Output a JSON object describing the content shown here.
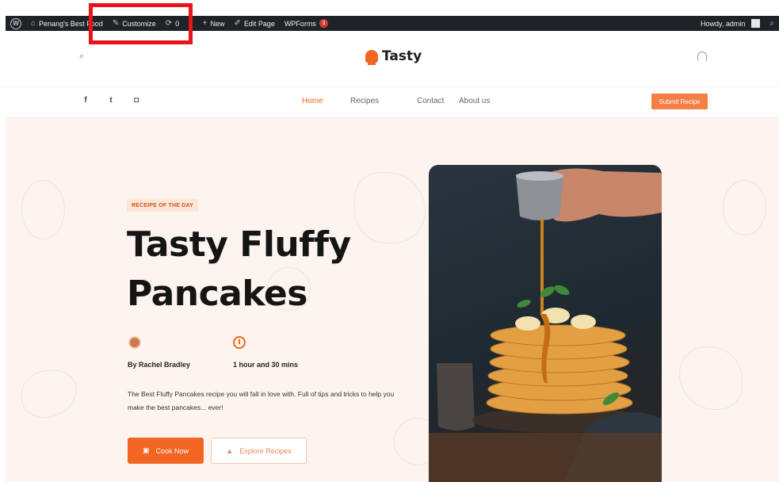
{
  "admin_bar": {
    "site_name": "Penang's Best Food",
    "customize": "Customize",
    "updates_count": "0",
    "new_label": "New",
    "edit_page": "Edit Page",
    "wpforms": "WPForms",
    "wpforms_badge": "3",
    "howdy": "Howdy, admin"
  },
  "header": {
    "logo_text": "Tasty",
    "menu": [
      "Home",
      "Recipes",
      "Contact",
      "About us"
    ],
    "submit_recipe": "Submit Recipe"
  },
  "hero": {
    "tag": "RECEIPE OF THE DAY",
    "title_line1": "Tasty Fluffy",
    "title_line2": "Pancakes",
    "author": "By Rachel Bradley",
    "duration": "1 hour and 30 mins",
    "description": "The Best Fluffy Pancakes recipe you will fall in love with. Full of tips and tricks to help you make the best pancakes... ever!",
    "cook_now": "Cook Now",
    "explore_recipes": "Explore Recipes"
  },
  "colors": {
    "accent": "#f26522",
    "admin_bar": "#1d2327",
    "hero_bg": "#fdf4ef",
    "highlight": "#e8131b"
  }
}
